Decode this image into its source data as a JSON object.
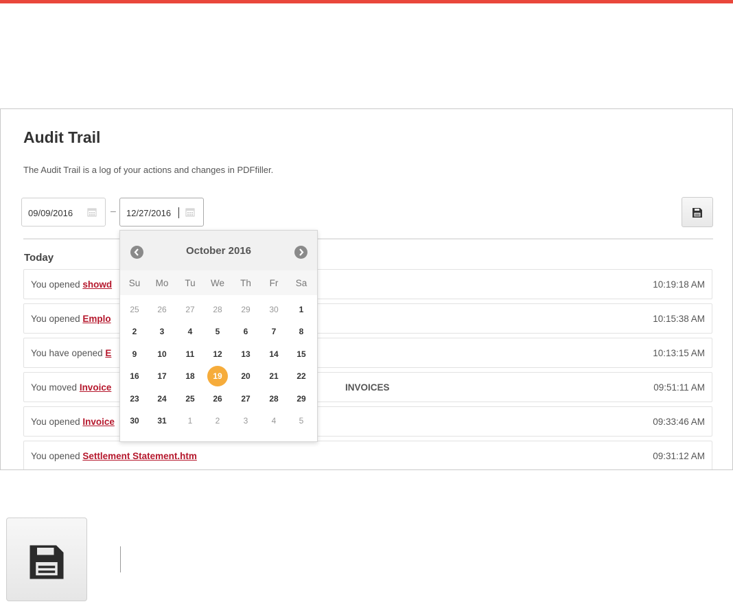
{
  "page": {
    "title": "Audit Trail",
    "subtitle": "The Audit Trail is a log of your actions and changes in PDFfiller."
  },
  "filters": {
    "start_date": "09/09/2016",
    "separator": "–",
    "end_date": "12/27/2016",
    "save_icon": "floppy-disk-icon",
    "date_icon": "calendar-icon"
  },
  "log": {
    "section_label": "Today",
    "rows": [
      {
        "prefix": "You opened ",
        "link": "showd",
        "suffix": "",
        "time": "10:19:18 AM"
      },
      {
        "prefix": "You opened ",
        "link": "Emplo",
        "suffix": "",
        "time": "10:15:38 AM"
      },
      {
        "prefix": "You have opened ",
        "link": "E",
        "suffix": "",
        "time": "10:13:15 AM"
      },
      {
        "prefix": "You moved ",
        "link": "Invoice",
        "suffix": "INVOICES",
        "time": "09:51:11 AM"
      },
      {
        "prefix": "You opened ",
        "link": "Invoice",
        "suffix": "",
        "time": "09:33:46 AM"
      },
      {
        "prefix": "You opened ",
        "link": "Settlement Statement.htm",
        "suffix": "",
        "time": "09:31:12 AM"
      }
    ]
  },
  "calendar": {
    "month_label": "October 2016",
    "prev_icon": "chevron-left-icon",
    "next_icon": "chevron-right-icon",
    "weekdays": [
      "Su",
      "Mo",
      "Tu",
      "We",
      "Th",
      "Fr",
      "Sa"
    ],
    "weeks": [
      [
        {
          "d": "25",
          "m": "prev"
        },
        {
          "d": "26",
          "m": "prev"
        },
        {
          "d": "27",
          "m": "prev"
        },
        {
          "d": "28",
          "m": "prev"
        },
        {
          "d": "29",
          "m": "prev"
        },
        {
          "d": "30",
          "m": "prev"
        },
        {
          "d": "1",
          "m": "cur"
        }
      ],
      [
        {
          "d": "2",
          "m": "cur"
        },
        {
          "d": "3",
          "m": "cur"
        },
        {
          "d": "4",
          "m": "cur"
        },
        {
          "d": "5",
          "m": "cur"
        },
        {
          "d": "6",
          "m": "cur"
        },
        {
          "d": "7",
          "m": "cur"
        },
        {
          "d": "8",
          "m": "cur"
        }
      ],
      [
        {
          "d": "9",
          "m": "cur"
        },
        {
          "d": "10",
          "m": "cur"
        },
        {
          "d": "11",
          "m": "cur"
        },
        {
          "d": "12",
          "m": "cur"
        },
        {
          "d": "13",
          "m": "cur"
        },
        {
          "d": "14",
          "m": "cur"
        },
        {
          "d": "15",
          "m": "cur"
        }
      ],
      [
        {
          "d": "16",
          "m": "cur"
        },
        {
          "d": "17",
          "m": "cur"
        },
        {
          "d": "18",
          "m": "cur"
        },
        {
          "d": "19",
          "m": "sel"
        },
        {
          "d": "20",
          "m": "cur"
        },
        {
          "d": "21",
          "m": "cur"
        },
        {
          "d": "22",
          "m": "cur"
        }
      ],
      [
        {
          "d": "23",
          "m": "cur"
        },
        {
          "d": "24",
          "m": "cur"
        },
        {
          "d": "25",
          "m": "cur"
        },
        {
          "d": "26",
          "m": "cur"
        },
        {
          "d": "27",
          "m": "cur"
        },
        {
          "d": "28",
          "m": "cur"
        },
        {
          "d": "29",
          "m": "cur"
        }
      ],
      [
        {
          "d": "30",
          "m": "cur"
        },
        {
          "d": "31",
          "m": "cur"
        },
        {
          "d": "1",
          "m": "next"
        },
        {
          "d": "2",
          "m": "next"
        },
        {
          "d": "3",
          "m": "next"
        },
        {
          "d": "4",
          "m": "next"
        },
        {
          "d": "5",
          "m": "next"
        }
      ]
    ]
  },
  "colors": {
    "accent_bar": "#e9473b",
    "link": "#b5172c",
    "selected_day": "#f6ac3b"
  }
}
